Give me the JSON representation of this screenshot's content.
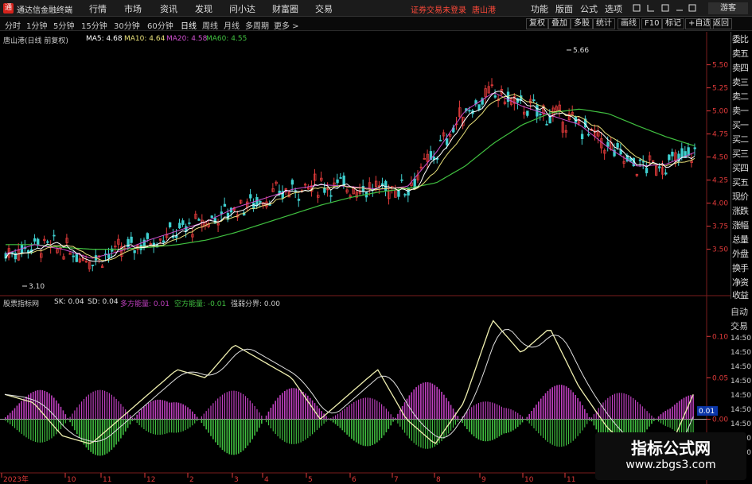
{
  "titlebar": {
    "app_title": "通达信金融终端",
    "logo_glyph": "通",
    "menus": [
      "行情",
      "市场",
      "资讯",
      "发现",
      "问小达",
      "财富圈",
      "交易"
    ],
    "login_note": "证券交易未登录",
    "stock_name": "唐山港",
    "right_menus": [
      "功能",
      "版面",
      "公式",
      "选项"
    ],
    "guest": "游客"
  },
  "toolbar": {
    "periods": [
      "分时",
      "1分钟",
      "5分钟",
      "15分钟",
      "30分钟",
      "60分钟",
      "日线",
      "周线",
      "月线",
      "多周期",
      "更多 >"
    ],
    "active_period": "日线",
    "buttons": [
      "复权",
      "叠加",
      "多股",
      "统计",
      "画线",
      "F10",
      "标记",
      "+自选",
      "返回"
    ]
  },
  "ma_legend": {
    "stock": "唐山港(日线 前复权)",
    "ma5_label": "MA5: 4.68",
    "ma10_label": "MA10: 4.64",
    "ma20_label": "MA20: 4.58",
    "ma60_label": "MA60: 4.55"
  },
  "indicator_legend": {
    "name": "股票指标网",
    "sk_label": "SK: 0.04",
    "sd_label": "SD: 0.04",
    "bull_label": "多方能量: 0.01",
    "bear_label": "空方能量: -0.01",
    "split_label": "强弱分界: 0.00"
  },
  "quote_list": [
    "委比",
    "卖五",
    "卖四",
    "卖三",
    "卖二",
    "卖一",
    "买一",
    "买二",
    "买三",
    "买四",
    "买五",
    "现价",
    "涨跌",
    "涨幅",
    "总量",
    "外盘",
    "换手",
    "净资",
    "收益"
  ],
  "side": {
    "auto": "自动",
    "trade": "交易",
    "times": [
      "14:50",
      "14:50",
      "14:50",
      "14:50",
      "14:50",
      "14:50",
      "14:50",
      "14:50",
      "14:50"
    ]
  },
  "watermark": {
    "title": "指标公式网",
    "url": "www.zbgs3.com"
  },
  "colors": {
    "up": "#e03a3a",
    "down": "#3fd0d0",
    "ma5": "#ffffff",
    "ma10": "#e8e07a",
    "ma20": "#d050d0",
    "ma60": "#40c040",
    "bull": "#c040c0",
    "bear": "#40c040",
    "sk": "#f0f0b0"
  },
  "chart_data": {
    "type": "candlestick",
    "price_axis": {
      "ticks": [
        5.5,
        5.25,
        5.0,
        4.75,
        4.5,
        4.25,
        4.0,
        3.75,
        3.5
      ],
      "tick_labels": [
        "5.50",
        "5.25",
        "5.00",
        "4.75",
        "4.50",
        "4.25",
        "4.00",
        "3.75",
        "3.50"
      ],
      "ylim": [
        3.1,
        5.72
      ]
    },
    "annotations": {
      "high_label": "5.66",
      "low_label": "3.10"
    },
    "indicator_axis": {
      "ticks": [
        0.1,
        0.05,
        0.01,
        0.0
      ],
      "tick_labels": [
        "0.10",
        "0.05",
        "0.01",
        "0.00"
      ],
      "current_label": "0.01",
      "ylim": [
        -0.06,
        0.13
      ]
    },
    "x_labels": [
      "2023年",
      "10",
      "11",
      "12",
      "2",
      "3",
      "4",
      "5",
      "6",
      "7",
      "8",
      "9",
      "10",
      "11"
    ],
    "ma60": [
      3.55,
      3.55,
      3.52,
      3.5,
      3.5,
      3.52,
      3.55,
      3.6,
      3.68,
      3.78,
      3.88,
      3.98,
      4.06,
      4.12,
      4.16,
      4.22,
      4.4,
      4.65,
      4.85,
      4.98,
      5.02,
      4.97,
      4.84,
      4.72,
      4.62
    ],
    "ma20": [
      3.45,
      3.55,
      3.5,
      3.4,
      3.48,
      3.6,
      3.7,
      3.8,
      3.95,
      4.05,
      4.15,
      4.2,
      4.18,
      4.15,
      4.18,
      4.55,
      5.0,
      5.2,
      5.05,
      4.95,
      4.85,
      4.6,
      4.4,
      4.42,
      4.55
    ],
    "sk": [
      0.03,
      0.02,
      -0.02,
      -0.03,
      0.0,
      0.03,
      0.06,
      0.05,
      0.09,
      0.07,
      0.05,
      0.0,
      0.03,
      0.06,
      0.0,
      -0.03,
      0.02,
      0.12,
      0.08,
      0.11,
      0.04,
      -0.01,
      -0.04,
      -0.05,
      0.03
    ]
  }
}
